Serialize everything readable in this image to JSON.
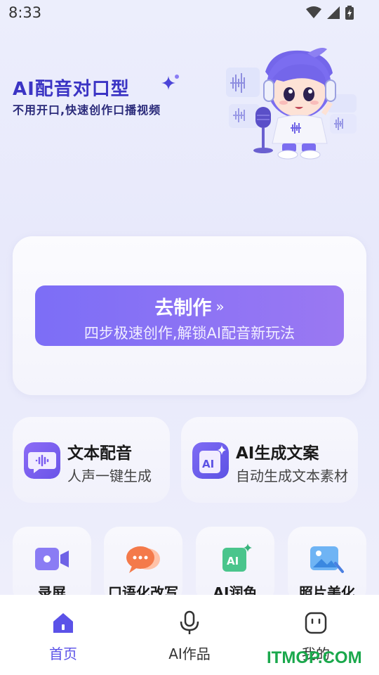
{
  "status_bar": {
    "time": "8:33"
  },
  "hero": {
    "title": "AI配音对口型",
    "subtitle": "不用开口,快速创作口播视频"
  },
  "main_card": {
    "button_title": "去制作",
    "button_chevron": "»",
    "button_subtitle": "四步极速创作,解锁AI配音新玩法"
  },
  "features": [
    {
      "title": "文本配音",
      "subtitle": "人声一键生成",
      "icon": "voice-wave-icon",
      "color": "#7a5cf0"
    },
    {
      "title": "AI生成文案",
      "subtitle": "自动生成文本素材",
      "icon": "ai-doc-icon",
      "color": "#6f63f2"
    }
  ],
  "tools": [
    {
      "label": "录屏",
      "icon": "video-camera-icon"
    },
    {
      "label": "口语化改写",
      "icon": "chat-bubble-icon"
    },
    {
      "label": "AI润色",
      "icon": "ai-sparkle-icon"
    },
    {
      "label": "照片美化",
      "icon": "photo-icon"
    }
  ],
  "bottom_nav": [
    {
      "label": "首页",
      "icon": "home-icon",
      "active": true
    },
    {
      "label": "AI作品",
      "icon": "microphone-icon",
      "active": false
    },
    {
      "label": "我的",
      "icon": "profile-face-icon",
      "active": false
    }
  ],
  "watermark": "ITMOP.COM",
  "colors": {
    "accent": "#5b52e8",
    "button_start": "#7c6ef6",
    "button_end": "#9a78f2",
    "title": "#3b34c4"
  }
}
